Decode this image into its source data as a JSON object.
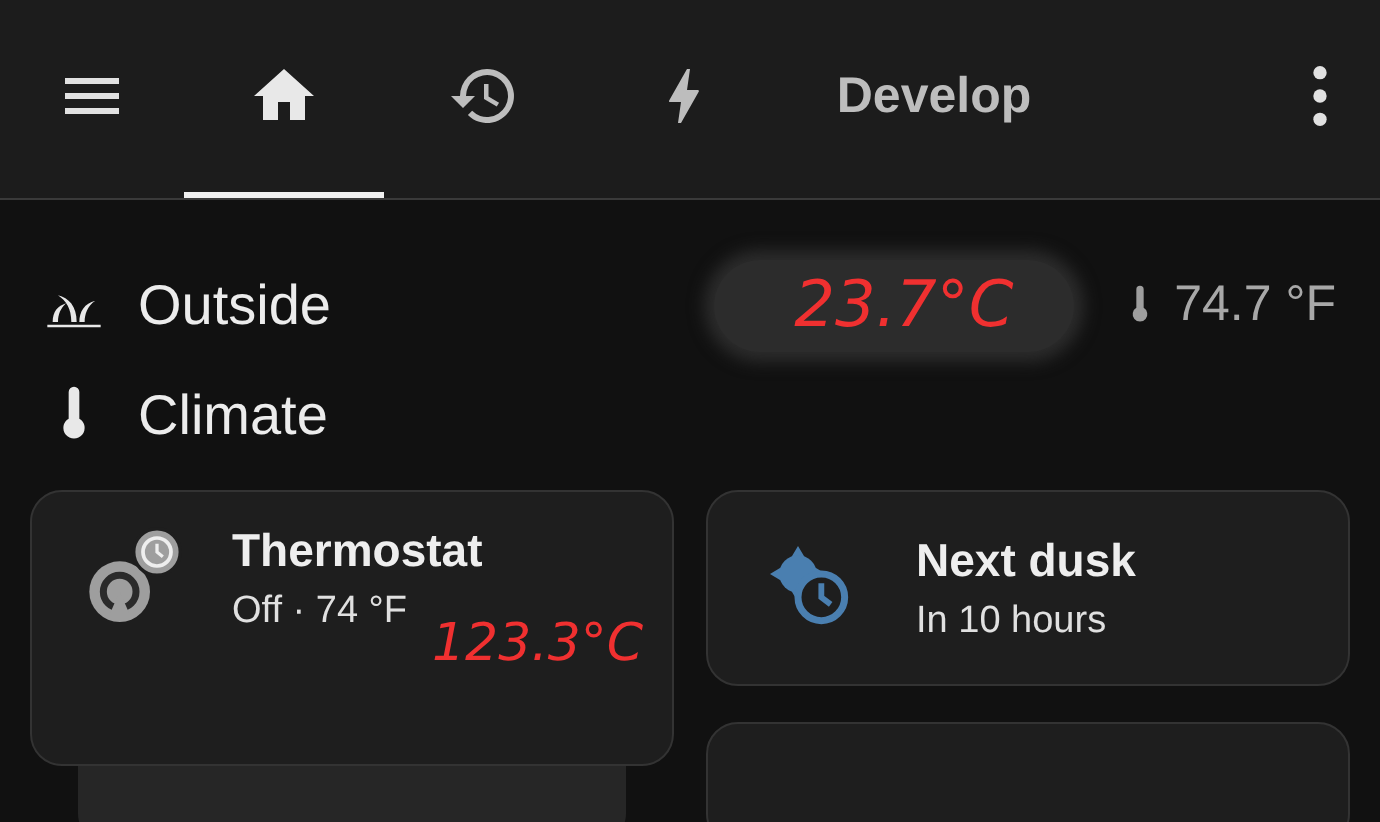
{
  "tabs": [
    {
      "kind": "menu",
      "selected": false
    },
    {
      "kind": "home",
      "selected": true
    },
    {
      "kind": "history",
      "selected": false
    },
    {
      "kind": "energy",
      "selected": false
    },
    {
      "kind": "text",
      "label": "Develop",
      "selected": false
    },
    {
      "kind": "more",
      "selected": false
    }
  ],
  "outside": {
    "title": "Outside",
    "temperature": "74.7 °F"
  },
  "climate": {
    "title": "Climate"
  },
  "cards": [
    {
      "kind": "thermostat",
      "name": "Thermostat",
      "state": "Off · 74 °F"
    },
    {
      "kind": "dusk",
      "name": "Next dusk",
      "state": "In 10 hours"
    }
  ],
  "annotations": [
    "23.7°C",
    "123.3°C"
  ]
}
